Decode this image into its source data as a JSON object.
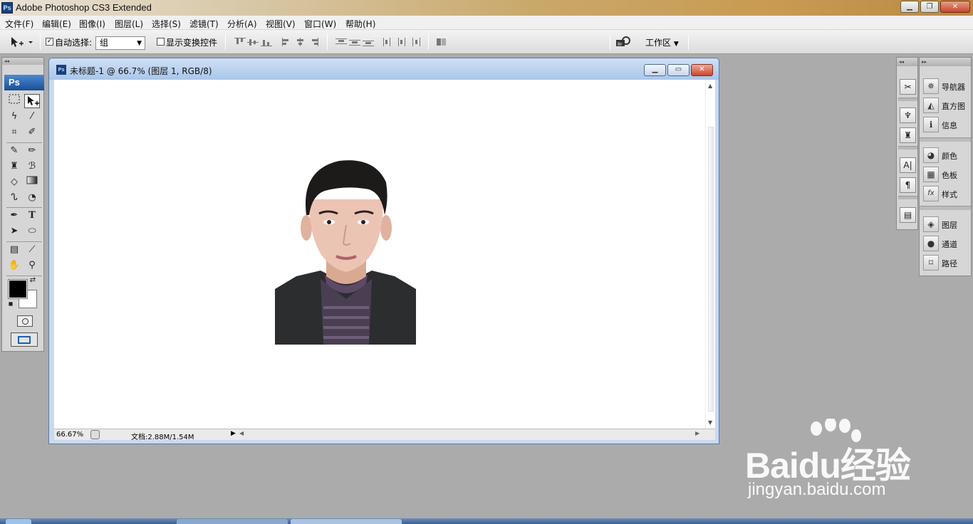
{
  "app": {
    "title": "Adobe Photoshop CS3 Extended",
    "logo": "Ps",
    "window_buttons": [
      "minimize",
      "maximize",
      "close"
    ]
  },
  "menu": [
    {
      "label": "文件(F)"
    },
    {
      "label": "编辑(E)"
    },
    {
      "label": "图像(I)"
    },
    {
      "label": "图层(L)"
    },
    {
      "label": "选择(S)"
    },
    {
      "label": "滤镜(T)"
    },
    {
      "label": "分析(A)"
    },
    {
      "label": "视图(V)"
    },
    {
      "label": "窗口(W)"
    },
    {
      "label": "帮助(H)"
    }
  ],
  "options": {
    "auto_select_label": "自动选择:",
    "auto_select_checked": true,
    "group_value": "组",
    "show_transform_label": "显示变换控件",
    "show_transform_checked": false,
    "workspace_label": "工作区"
  },
  "toolbox": {
    "logo": "Ps",
    "foreground_color": "#000000",
    "background_color": "#ffffff"
  },
  "document": {
    "title": "未标题-1 @ 66.7% (图层 1, RGB/8)",
    "zoom": "66.67%",
    "doc_size": "文档:2.88M/1.54M",
    "icon": "Ps"
  },
  "panels": {
    "group1": [
      {
        "label": "导航器",
        "icon": "navigator-icon"
      },
      {
        "label": "直方图",
        "icon": "histogram-icon"
      },
      {
        "label": "信息",
        "icon": "info-icon"
      }
    ],
    "group2": [
      {
        "label": "颜色",
        "icon": "color-icon"
      },
      {
        "label": "色板",
        "icon": "swatches-icon"
      },
      {
        "label": "样式",
        "icon": "styles-icon"
      }
    ],
    "group3": [
      {
        "label": "图层",
        "icon": "layers-icon"
      },
      {
        "label": "通道",
        "icon": "channels-icon"
      },
      {
        "label": "路径",
        "icon": "paths-icon"
      }
    ]
  },
  "watermark": {
    "brand": "Baidu经验",
    "url": "jingyan.baidu.com"
  }
}
